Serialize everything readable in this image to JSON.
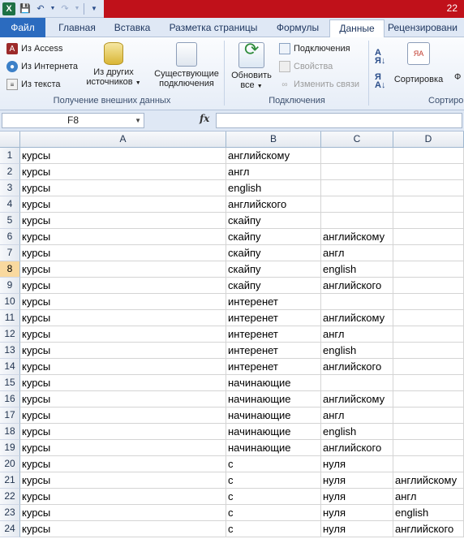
{
  "title_bar": {
    "title_fragment": "22"
  },
  "tabs": [
    {
      "label": "Файл",
      "left": 0
    },
    {
      "label": "Главная"
    },
    {
      "label": "Вставка"
    },
    {
      "label": "Разметка страницы"
    },
    {
      "label": "Формулы"
    },
    {
      "label": "Данные"
    },
    {
      "label": "Рецензировани"
    }
  ],
  "active_tab": "Данные",
  "ribbon": {
    "external_data": {
      "from_access": "Из Access",
      "from_web": "Из Интернета",
      "from_text": "Из текста",
      "from_other_1": "Из других",
      "from_other_2": "источников",
      "existing_1": "Существующие",
      "existing_2": "подключения",
      "group_label": "Получение внешних данных"
    },
    "connections": {
      "refresh_1": "Обновить",
      "refresh_2": "все",
      "connections": "Подключения",
      "properties": "Свойства",
      "edit_links": "Изменить связи",
      "group_label": "Подключения"
    },
    "sort": {
      "sort_label": "Сортировка",
      "filter_fragment": "Ф",
      "group_label": "Сортиро"
    }
  },
  "formula_bar": {
    "name_box": "F8",
    "fx": "fx",
    "value": ""
  },
  "columns": [
    "A",
    "B",
    "C",
    "D"
  ],
  "rows": [
    {
      "n": "1",
      "a": "курсы",
      "b": "английскому",
      "c": "",
      "d": ""
    },
    {
      "n": "2",
      "a": "курсы",
      "b": "англ",
      "c": "",
      "d": ""
    },
    {
      "n": "3",
      "a": "курсы",
      "b": "english",
      "c": "",
      "d": ""
    },
    {
      "n": "4",
      "a": "курсы",
      "b": "английского",
      "c": "",
      "d": ""
    },
    {
      "n": "5",
      "a": "курсы",
      "b": "скайпу",
      "c": "",
      "d": ""
    },
    {
      "n": "6",
      "a": "курсы",
      "b": "скайпу",
      "c": "английскому",
      "d": ""
    },
    {
      "n": "7",
      "a": "курсы",
      "b": "скайпу",
      "c": "англ",
      "d": ""
    },
    {
      "n": "8",
      "a": "курсы",
      "b": "скайпу",
      "c": "english",
      "d": ""
    },
    {
      "n": "9",
      "a": "курсы",
      "b": "скайпу",
      "c": "английского",
      "d": ""
    },
    {
      "n": "10",
      "a": "курсы",
      "b": "интеренет",
      "c": "",
      "d": ""
    },
    {
      "n": "11",
      "a": "курсы",
      "b": "интеренет",
      "c": "английскому",
      "d": ""
    },
    {
      "n": "12",
      "a": "курсы",
      "b": "интеренет",
      "c": "англ",
      "d": ""
    },
    {
      "n": "13",
      "a": "курсы",
      "b": "интеренет",
      "c": "english",
      "d": ""
    },
    {
      "n": "14",
      "a": "курсы",
      "b": "интеренет",
      "c": "английского",
      "d": ""
    },
    {
      "n": "15",
      "a": "курсы",
      "b": "начинающие",
      "c": "",
      "d": ""
    },
    {
      "n": "16",
      "a": "курсы",
      "b": "начинающие",
      "c": "английскому",
      "d": ""
    },
    {
      "n": "17",
      "a": "курсы",
      "b": "начинающие",
      "c": "англ",
      "d": ""
    },
    {
      "n": "18",
      "a": "курсы",
      "b": "начинающие",
      "c": "english",
      "d": ""
    },
    {
      "n": "19",
      "a": "курсы",
      "b": "начинающие",
      "c": "английского",
      "d": ""
    },
    {
      "n": "20",
      "a": "курсы",
      "b": "с",
      "c": "нуля",
      "d": ""
    },
    {
      "n": "21",
      "a": "курсы",
      "b": "с",
      "c": "нуля",
      "d": "английскому"
    },
    {
      "n": "22",
      "a": "курсы",
      "b": "с",
      "c": "нуля",
      "d": "англ"
    },
    {
      "n": "23",
      "a": "курсы",
      "b": "с",
      "c": "нуля",
      "d": "english"
    },
    {
      "n": "24",
      "a": "курсы",
      "b": "с",
      "c": "нуля",
      "d": "английского"
    }
  ],
  "selected_row": "8"
}
